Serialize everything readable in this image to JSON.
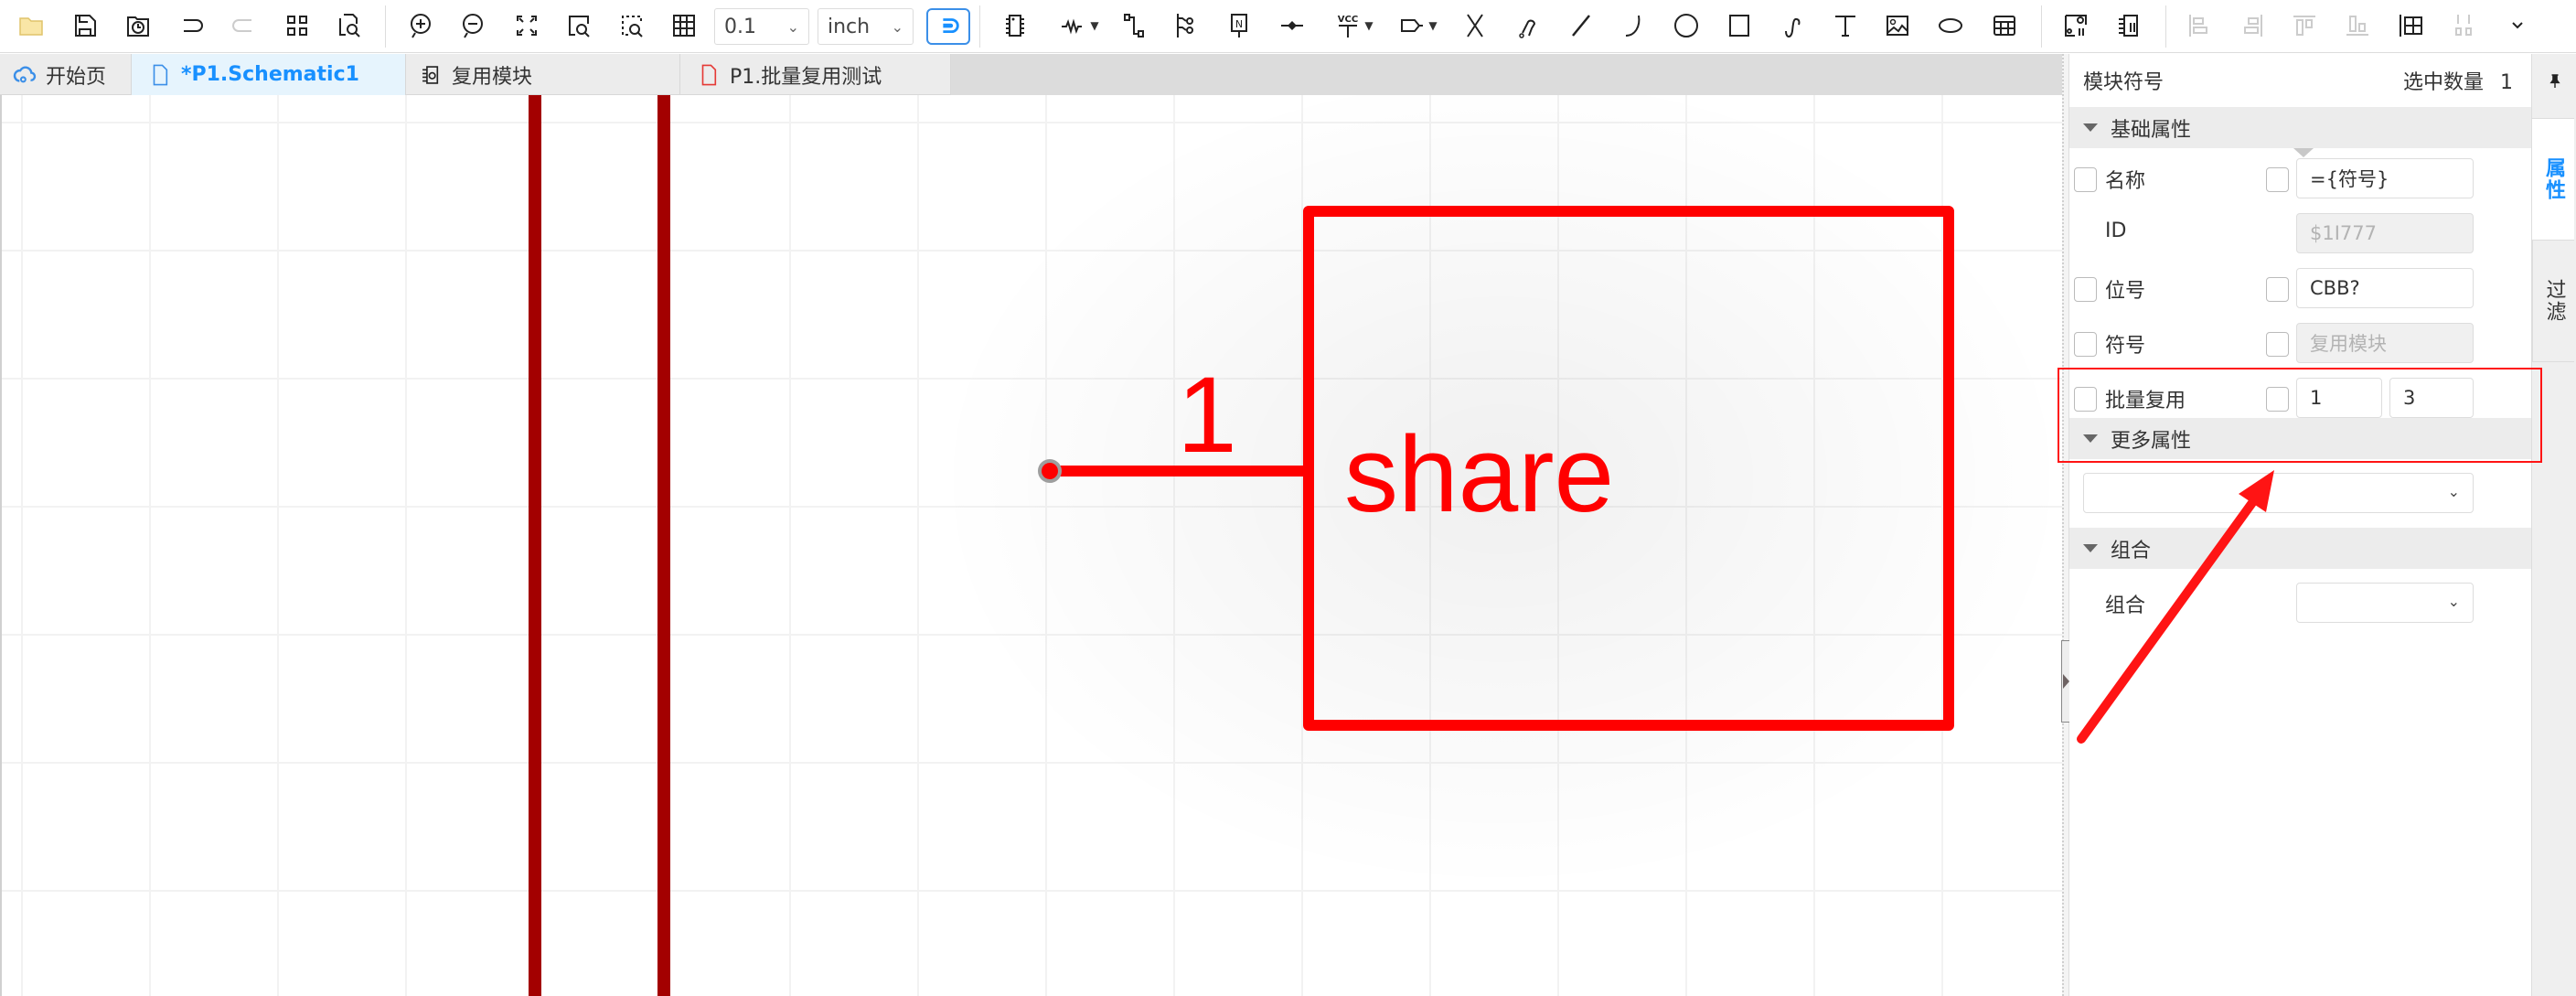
{
  "toolbar": {
    "grid_size": "0.1",
    "unit": "inch",
    "icons": [
      "open-folder-icon",
      "save-icon",
      "history-icon",
      "undo-icon",
      "redo-icon",
      "layout-grid-icon",
      "find-icon",
      "zoom-in-icon",
      "zoom-out-icon",
      "fit-icon",
      "zoom-area-icon",
      "zoom-selection-icon",
      "grid-icon",
      "snap-toggle-icon",
      "component-icon",
      "resistor-icon",
      "wire-icon",
      "bus-icon",
      "net-label-icon",
      "junction-icon",
      "vcc-icon",
      "net-port-icon",
      "no-connect-icon",
      "probe-icon",
      "line-icon",
      "arc-icon",
      "circle-icon",
      "rectangle-icon",
      "bezier-icon",
      "text-icon",
      "image-icon",
      "ellipse-icon",
      "table-icon",
      "symbol-update-icon",
      "module-update-icon",
      "align-left-icon",
      "align-right-icon",
      "align-top-icon",
      "align-bottom-icon",
      "distribute-grid-icon",
      "distribute-icon",
      "more-icon"
    ]
  },
  "tabs": [
    {
      "label": "开始页",
      "icon": "cloud-icon",
      "active": false
    },
    {
      "label": "*P1.Schematic1",
      "icon": "document-icon",
      "active": true
    },
    {
      "label": "复用模块",
      "icon": "module-icon",
      "active": false
    },
    {
      "label": "P1.批量复用测试",
      "icon": "document-red-icon",
      "active": false
    }
  ],
  "canvas": {
    "pin_number": "1",
    "symbol_text": "share",
    "colors": {
      "symbol": "#ff0000",
      "bus": "#a30000",
      "pin_dot": "#9e9e9e"
    }
  },
  "panel": {
    "title": "模块符号",
    "selected_label": "选中数量",
    "selected_count": "1",
    "sections": {
      "basic": "基础属性",
      "more": "更多属性",
      "group": "组合"
    },
    "rows": {
      "name": {
        "label": "名称",
        "value": "={符号}"
      },
      "id": {
        "label": "ID",
        "value": "$1I777"
      },
      "designator": {
        "label": "位号",
        "value": "CBB?"
      },
      "symbol": {
        "label": "符号",
        "value": "复用模块"
      },
      "batch": {
        "label": "批量复用",
        "value_start": "1",
        "value_count": "3"
      }
    },
    "group_label": "组合",
    "group_value": ""
  },
  "vtabs": {
    "properties": "属性",
    "filter": "过滤"
  },
  "annotation": {
    "color": "#ff1414"
  }
}
